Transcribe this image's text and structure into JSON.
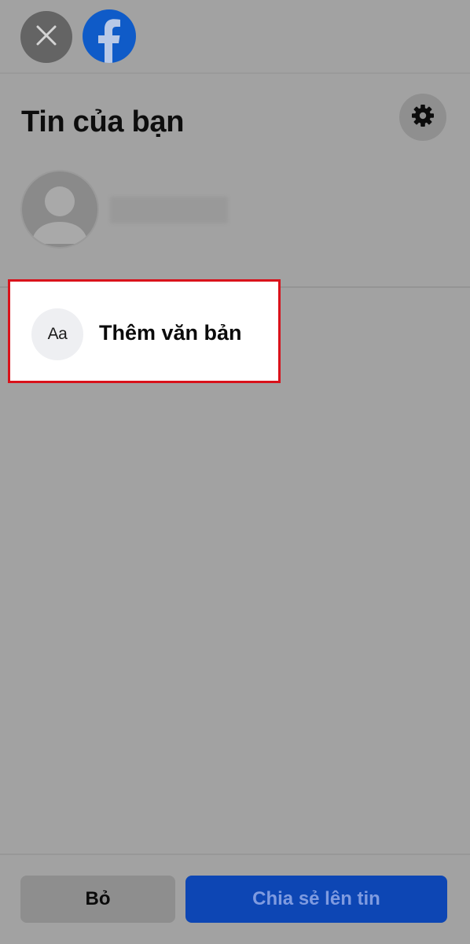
{
  "header": {
    "close_icon": "close-icon",
    "logo_icon": "facebook-logo-icon"
  },
  "main": {
    "title": "Tin của bạn",
    "settings_icon": "gear-icon",
    "profile": {
      "avatar_icon": "default-avatar-icon"
    },
    "options": [
      {
        "icon_text": "Aa",
        "label": "Thêm văn bản"
      }
    ]
  },
  "footer": {
    "discard_label": "Bỏ",
    "share_label": "Chia sẻ lên tin"
  },
  "colors": {
    "overlay": "#a2a2a2",
    "facebook_blue": "#0f5bc8",
    "share_button": "#0d46b4",
    "highlight_border": "#d9121b"
  }
}
